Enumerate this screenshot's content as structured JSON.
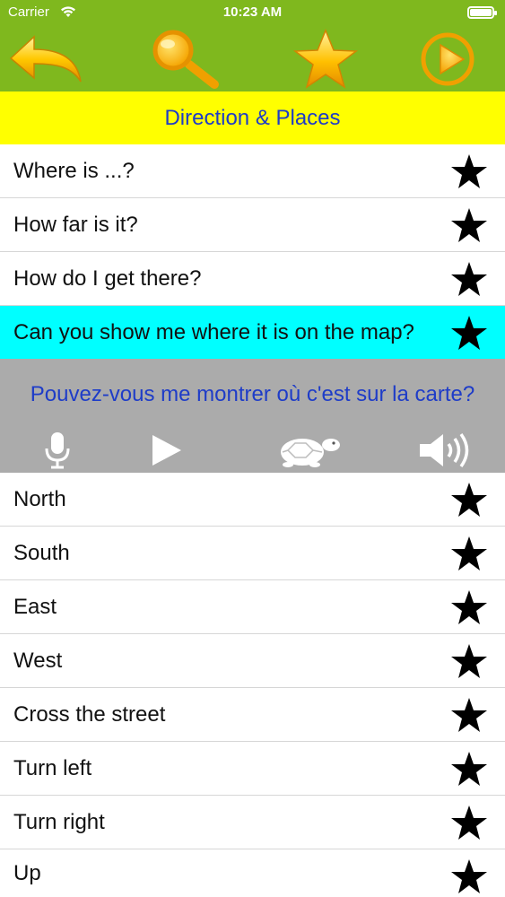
{
  "status_bar": {
    "carrier": "Carrier",
    "time": "10:23 AM",
    "wifi_icon": "wifi-icon",
    "battery_icon": "battery-icon"
  },
  "toolbar": {
    "back_icon": "back-arrow-icon",
    "search_icon": "search-icon",
    "favorites_icon": "star-icon",
    "play_icon": "play-circle-icon"
  },
  "category": {
    "title": "Direction & Places"
  },
  "phrases_top": [
    {
      "label": "Where is ...?"
    },
    {
      "label": "How far is it?"
    },
    {
      "label": "How do I get there?"
    },
    {
      "label": "Can you show me where it is on the map?",
      "selected": true
    }
  ],
  "translation": {
    "text": "Pouvez-vous me montrer où c'est sur la carte?",
    "controls": {
      "record_icon": "microphone-icon",
      "play_icon": "play-icon",
      "slow_icon": "turtle-icon",
      "speaker_icon": "speaker-icon"
    }
  },
  "phrases_bottom": [
    {
      "label": "North"
    },
    {
      "label": "South"
    },
    {
      "label": "East"
    },
    {
      "label": "West"
    },
    {
      "label": "Cross the street"
    },
    {
      "label": "Turn left"
    },
    {
      "label": "Turn right"
    },
    {
      "label": "Up"
    }
  ],
  "colors": {
    "header_green": "#7fb81e",
    "title_yellow": "#ffff00",
    "selected_cyan": "#00ffff",
    "panel_gray": "#ababab",
    "text_blue": "#1e3cc8"
  }
}
